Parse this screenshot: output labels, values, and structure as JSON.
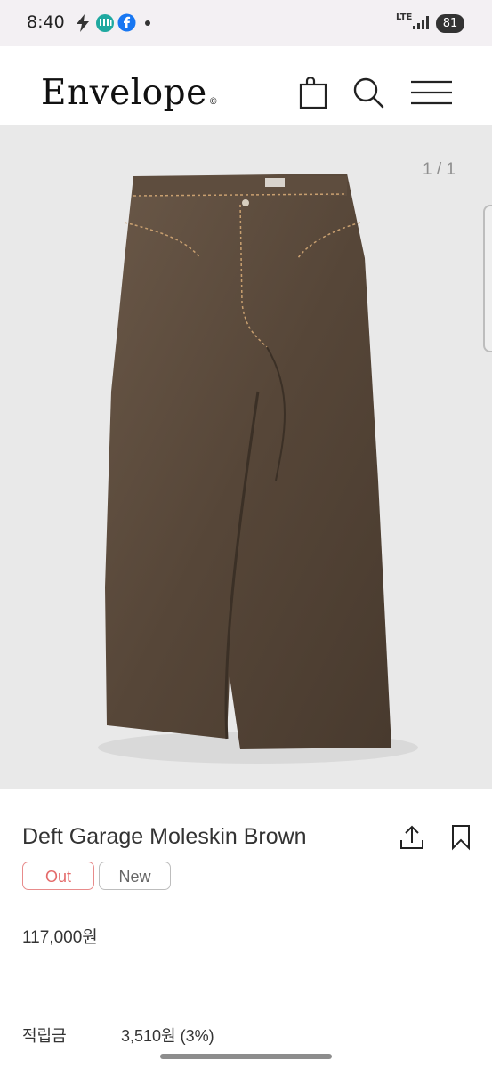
{
  "status_bar": {
    "time": "8:40",
    "network": "LTE",
    "battery": "81"
  },
  "header": {
    "logo": "Envelope",
    "logo_mark": "©",
    "icons": [
      "shopping-bag-icon",
      "search-icon",
      "menu-icon"
    ]
  },
  "gallery": {
    "counter": "1 / 1",
    "image_subject": "brown wide-leg denim pants"
  },
  "product": {
    "title": "Deft Garage Moleskin Brown",
    "badges": [
      "Out",
      "New"
    ],
    "price": "117,000원",
    "points_label": "적립금",
    "points_value": "3,510원 (3%)"
  },
  "colors": {
    "badge_out": "#e46a6a",
    "pants": "#5a4a3c",
    "gallery_bg": "#e9e9e9"
  }
}
